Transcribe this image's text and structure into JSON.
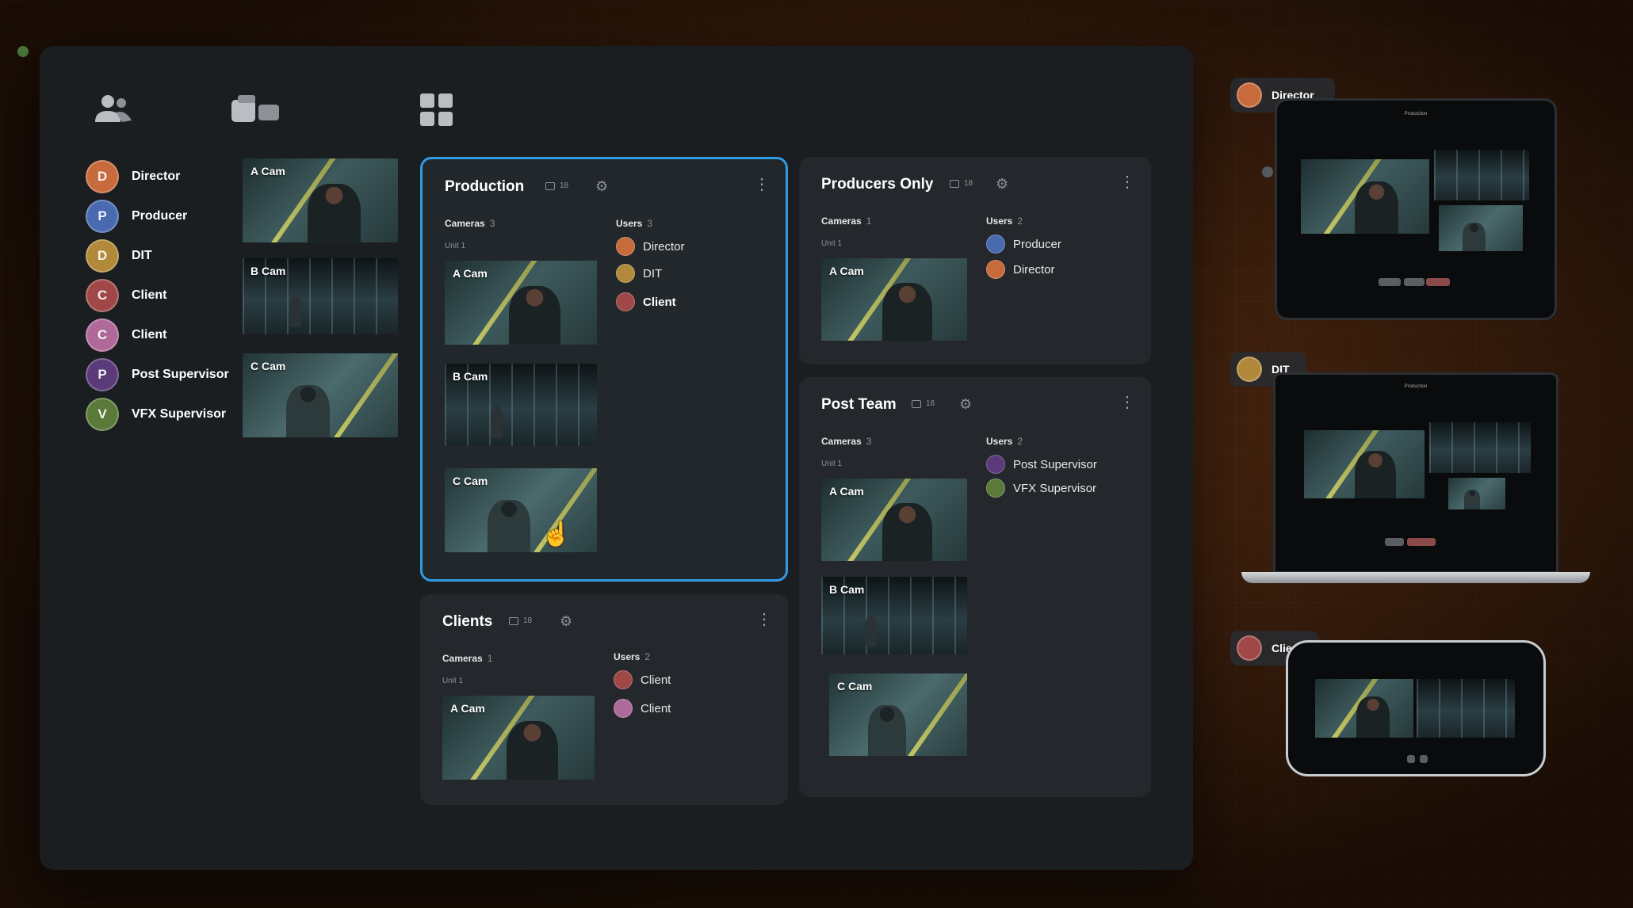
{
  "users": [
    {
      "name": "Director",
      "initial": "D",
      "color": "#c76a3c"
    },
    {
      "name": "Producer",
      "initial": "P",
      "color": "#4a6ab0"
    },
    {
      "name": "DIT",
      "initial": "D",
      "color": "#b08a3a"
    },
    {
      "name": "Client",
      "initial": "C",
      "color": "#a04848"
    },
    {
      "name": "Client",
      "initial": "C",
      "color": "#b06a9a"
    },
    {
      "name": "Post Supervisor",
      "initial": "P",
      "color": "#5a3a78"
    },
    {
      "name": "VFX Supervisor",
      "initial": "V",
      "color": "#5a7a3a"
    }
  ],
  "cameras": [
    "A Cam",
    "B Cam",
    "C Cam"
  ],
  "groups": {
    "production": {
      "title": "Production",
      "count": "18",
      "cameras_label": "Cameras",
      "cameras_count": "3",
      "unit": "Unit 1",
      "users_label": "Users",
      "users_count": "3",
      "cams": [
        "A Cam",
        "B Cam",
        "C Cam"
      ],
      "members": [
        "Director",
        "DIT",
        "Client"
      ]
    },
    "producers": {
      "title": "Producers Only",
      "count": "18",
      "cameras_label": "Cameras",
      "cameras_count": "1",
      "unit": "Unit 1",
      "users_label": "Users",
      "users_count": "2",
      "cams": [
        "A Cam"
      ],
      "members": [
        "Producer",
        "Director"
      ]
    },
    "post": {
      "title": "Post Team",
      "count": "18",
      "cameras_label": "Cameras",
      "cameras_count": "3",
      "unit": "Unit 1",
      "users_label": "Users",
      "users_count": "2",
      "cams": [
        "A Cam",
        "B Cam",
        "C Cam"
      ],
      "members": [
        "Post Supervisor",
        "VFX Supervisor"
      ]
    },
    "clients": {
      "title": "Clients",
      "count": "18",
      "cameras_label": "Cameras",
      "cameras_count": "1",
      "unit": "Unit 1",
      "users_label": "Users",
      "users_count": "2",
      "cams": [
        "A Cam"
      ],
      "members": [
        "Client",
        "Client"
      ]
    }
  },
  "devices": {
    "tablet": {
      "user": "Director",
      "screen_title": "Production"
    },
    "laptop": {
      "user": "DIT",
      "screen_title": "Production"
    },
    "phone": {
      "user": "Client"
    }
  },
  "icons": {
    "users_tab": "users-icon",
    "cameras_tab": "cameras-icon",
    "groups_tab": "grid-icon",
    "settings": "gear-icon",
    "menu": "kebab-icon",
    "pointer": "hand-cursor-icon"
  },
  "colors": {
    "accent": "#2f9be3",
    "panel": "#1b1e21",
    "card": "#24282c"
  }
}
